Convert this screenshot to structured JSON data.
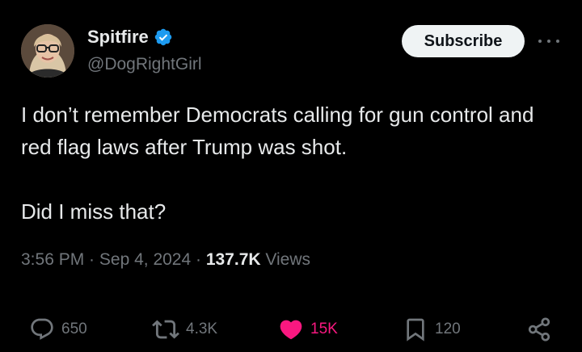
{
  "author": {
    "name": "Spitfire",
    "handle": "@DogRightGirl",
    "verified_color": "#1d9bf0"
  },
  "header": {
    "subscribe_label": "Subscribe",
    "more_icon": "more-horizontal-icon"
  },
  "tweet": {
    "paragraph1": "I don’t remember Democrats calling for gun control and red flag laws after Trump was shot.",
    "paragraph2": "Did I miss that?"
  },
  "meta": {
    "time": "3:56 PM",
    "sep1": " · ",
    "date": "Sep 4, 2024",
    "sep2": " · ",
    "views_count": "137.7K",
    "views_label": " Views"
  },
  "actions": {
    "replies": "650",
    "reposts": "4.3K",
    "likes": "15K",
    "bookmarks": "120",
    "like_color": "#f91880"
  }
}
